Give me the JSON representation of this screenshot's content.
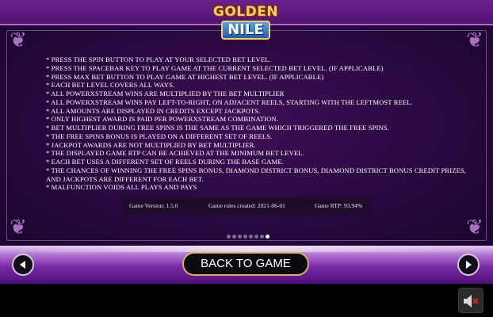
{
  "logo": {
    "line1": "GOLDEN",
    "line2": "NILE"
  },
  "rules": [
    "* PRESS THE SPIN BUTTON TO PLAY AT YOUR SELECTED BET LEVEL.",
    "* PRESS THE SPACEBAR KEY TO PLAY GAME AT THE CURRENT SELECTED BET LEVEL. (IF APPLICABLE)",
    "* PRESS MAX BET BUTTON TO PLAY GAME AT HIGHEST BET LEVEL. (IF APPLICABLE)",
    "* EACH BET LEVEL COVERS ALL WAYS.",
    "* ALL POWERXSTREAM WINS ARE MULTIPLIED BY THE BET MULTIPLIER",
    "* ALL POWERXSTREAM WINS PAY LEFT-TO-RIGHT, ON ADJACENT REELS, STARTING WITH THE LEFTMOST REEL.",
    "* ALL AMOUNTS ARE DISPLAYED IN CREDITS EXCEPT JACKPOTS.",
    "* ONLY HIGHEST AWARD IS PAID PER POWERXSTREAM COMBINATION.",
    "* BET MULTIPLIER DURING FREE SPINS IS THE SAME AS THE GAME WHICH TRIGGERED THE FREE SPINS.",
    "* THE FREE SPINS BONUS IS PLAYED ON A DIFFERENT SET OF REELS.",
    "* JACKPOT AWARDS ARE NOT MULTIPLIED BY BET MULTIPLIER.",
    "* THE DISPLAYED GAME RTP CAN BE ACHIEVED AT THE MINIMUM BET LEVEL.",
    "* EACH BET USES A DIFFERENT SET OF REELS DURING THE BASE GAME.",
    "* THE CHANCES OF WINNING THE FREE SPINS BONUS, DIAMOND DISTRICT BONUS, DIAMOND DISTRICT BONUS CREDIT PRIZES,",
    "AND JACKPOTS ARE DIFFERENT FOR EACH BET.",
    "* MALFUNCTION VOIDS ALL PLAYS AND PAYS"
  ],
  "info": {
    "version": "Game Version: 1.5.0",
    "created": "Game rules created: 2021-06-01",
    "rtp": "Game RTP: 93.94%"
  },
  "pagination": {
    "total_pages": 8,
    "current_page": 8
  },
  "back_button_label": "BACK TO GAME",
  "icons": {
    "prev": "arrow-left-icon",
    "next": "arrow-right-icon",
    "sound": "speaker-muted-icon",
    "corner": "ornament-icon"
  },
  "colors": {
    "panel": "#2a0840",
    "border": "#b56bd1",
    "button_border": "#d9b25a",
    "text": "#ffffff",
    "mute_x": "#e02020"
  }
}
